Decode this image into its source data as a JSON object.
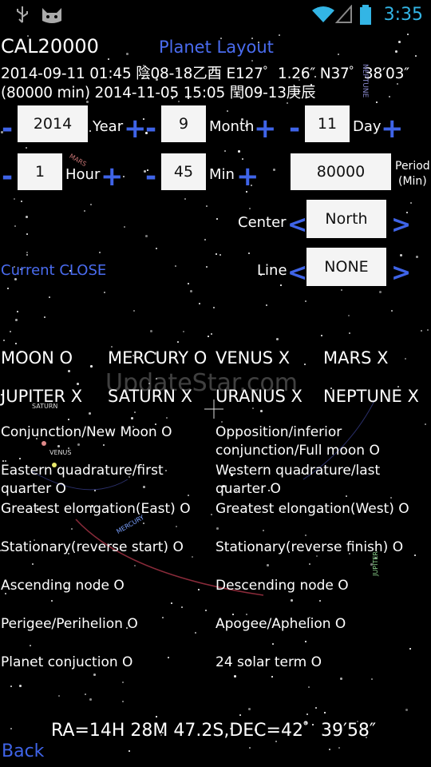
{
  "status_bar": {
    "time": "3:35",
    "icons": [
      "usb-icon",
      "cat-icon",
      "wifi-icon",
      "signal-icon",
      "battery-icon"
    ]
  },
  "header": {
    "title": "CAL20000",
    "subtitle": "Planet Layout",
    "line1": "2014-09-11 01:45 陰08-18乙酉 E127゜1.26″ N37゜38′03″",
    "line2": "(80000 min) 2014-11-05 15:05 閏09-13庚辰"
  },
  "date_controls": {
    "minus": "-",
    "plus": "+",
    "year": {
      "value": "2014",
      "label": "Year"
    },
    "month": {
      "value": "9",
      "label": "Month"
    },
    "day": {
      "value": "11",
      "label": "Day"
    },
    "hour": {
      "value": "1",
      "label": "Hour"
    },
    "min": {
      "value": "45",
      "label": "Min"
    },
    "period": {
      "value": "80000",
      "label_line1": "Period",
      "label_line2": "(Min)"
    }
  },
  "selectors": {
    "left_arrow": "<",
    "right_arrow": ">",
    "center": {
      "label": "Center",
      "value": "North"
    },
    "line": {
      "label": "Line",
      "value": "NONE"
    },
    "current": "Current  CLOSE"
  },
  "planets": [
    "MOON O",
    "MERCURY O",
    "VENUS X",
    "MARS X",
    "JUPITER X",
    "SATURN X",
    "URANUS X",
    "NEPTUNE X"
  ],
  "events": [
    "Conjunction/New Moon O",
    "Opposition/inferior conjunction/Full moon O",
    "Eastern quadrature/first quarter O",
    "Western quadrature/last quarter O",
    "Greatest elongation(East) O",
    "Greatest elongation(West) O",
    "Stationary(reverse start) O",
    "Stationary(reverse finish) O",
    "Ascending node O",
    "Descending node O",
    "Perigee/Perihelion O",
    "Apogee/Aphelion O",
    "Planet conjuction O",
    "24 solar term O"
  ],
  "sky_labels": {
    "neptune": "NEPTUNE",
    "mars": "MARS",
    "saturn": "SATURN",
    "venus": "VENUS",
    "mercury": "MERCURY",
    "jupiter": "JUPITER"
  },
  "radec": "RA=14H 28M 47.2S,DEC=42゜39′58″",
  "back": "Back",
  "watermark": "UpdateStar.com",
  "colors": {
    "accent": "#3f64e8",
    "status_blue": "#33b5e5",
    "background": "#000000"
  }
}
